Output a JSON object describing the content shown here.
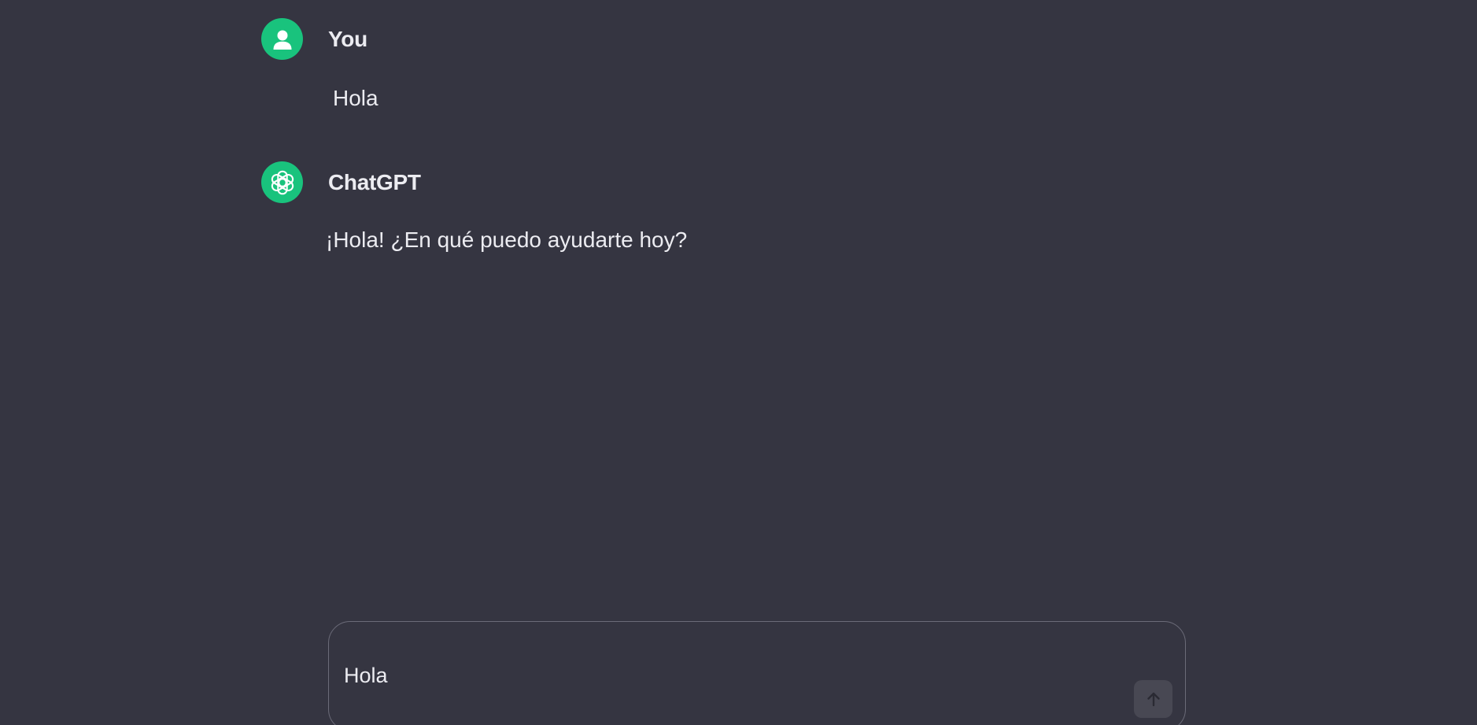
{
  "conversation": {
    "messages": [
      {
        "author": "You",
        "avatar_icon": "user-icon",
        "text": "Hola"
      },
      {
        "author": "ChatGPT",
        "avatar_icon": "openai-logo-icon",
        "text": "¡Hola! ¿En qué puedo ayudarte hoy?"
      }
    ]
  },
  "composer": {
    "value": "Hola",
    "send_icon": "arrow-up-icon"
  },
  "colors": {
    "background": "#353541",
    "avatar": "#19c37d",
    "text": "#ececf1",
    "send_button": "#484853"
  }
}
